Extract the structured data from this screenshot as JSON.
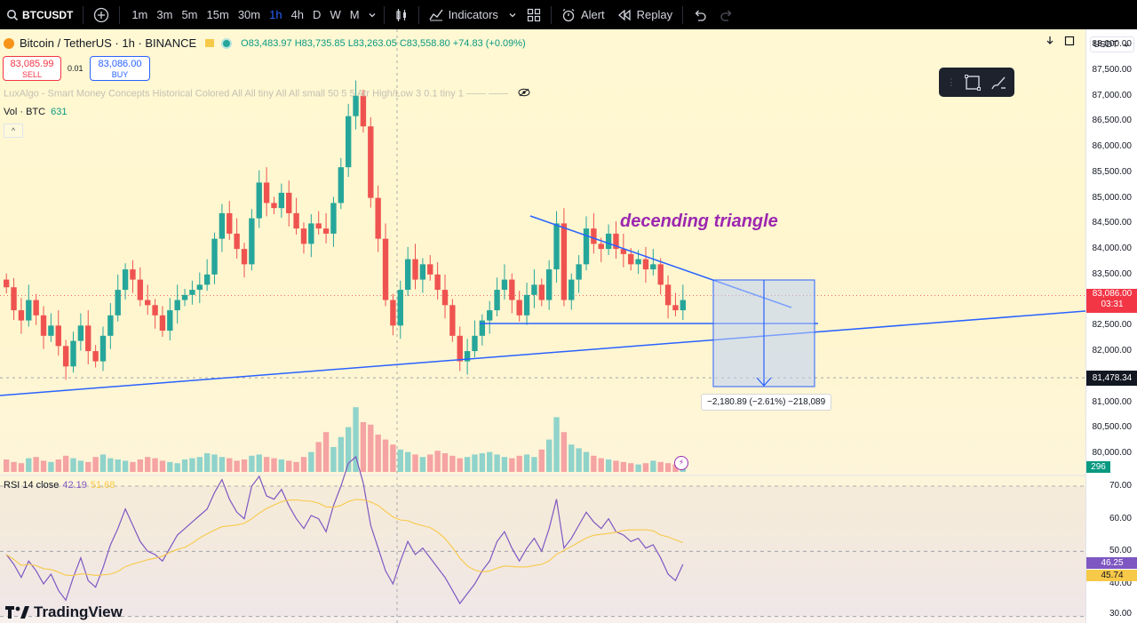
{
  "toolbar": {
    "symbol": "BTCUSDT",
    "timeframes": [
      {
        "label": "1m",
        "active": false
      },
      {
        "label": "3m",
        "active": false
      },
      {
        "label": "5m",
        "active": false
      },
      {
        "label": "15m",
        "active": false
      },
      {
        "label": "30m",
        "active": false
      },
      {
        "label": "1h",
        "active": true
      },
      {
        "label": "4h",
        "active": false
      },
      {
        "label": "D",
        "active": false
      },
      {
        "label": "W",
        "active": false
      },
      {
        "label": "M",
        "active": false
      }
    ],
    "indicators_label": "Indicators",
    "alert_label": "Alert",
    "replay_label": "Replay",
    "icons": [
      "search-icon",
      "add-symbol-icon",
      "chevron-down-icon",
      "candles-icon",
      "indicators-icon",
      "templates-icon",
      "alert-icon",
      "replay-icon",
      "undo-icon",
      "redo-icon"
    ]
  },
  "legend": {
    "title": "Bitcoin / TetherUS · 1h · BINANCE",
    "open": "O83,483.97",
    "high": "H83,735.85",
    "low": "L83,263.05",
    "close": "C83,558.80",
    "change": "+74.83 (+0.09%)"
  },
  "trade": {
    "sell_price": "83,085.99",
    "sell_label": "SELL",
    "spread": "0.01",
    "buy_price": "83,086.00",
    "buy_label": "BUY"
  },
  "indicator_legend": "LuxAlgo - Smart Money Concepts Historical Colored All All tiny All All small 50 5 5 Atr High/Low 3 0.1 tiny 1 —— ——",
  "volume_legend": {
    "label": "Vol · BTC",
    "value": "631"
  },
  "collapse_label": "^",
  "annotation": "decending triangle",
  "measure": "−2,180.89 (−2.61%) −218,089",
  "rsi_legend": {
    "label": "RSI 14 close",
    "value": "42.19",
    "ma": "51.68"
  },
  "brand": "TradingView",
  "price_axis": {
    "currency": "USDT",
    "ticks": [
      "88,000.00",
      "87,500.00",
      "87,000.00",
      "86,500.00",
      "86,000.00",
      "85,500.00",
      "85,000.00",
      "84,500.00",
      "84,000.00",
      "83,500.00",
      "82,500.00",
      "82,000.00",
      "81,000.00",
      "80,500.00",
      "80,000.00"
    ],
    "current_price": "83,086.00",
    "countdown": "03:31",
    "crosshair_price": "81,478.34",
    "volume_badge": "296",
    "rsi_ticks": [
      "70.00",
      "60.00",
      "50.00",
      "40.00",
      "30.00"
    ],
    "rsi_value": "46.25",
    "rsi_ma_value": "45.74"
  },
  "colors": {
    "up": "#26a69a",
    "down": "#ef5350",
    "trendline": "#2962ff",
    "rsi": "#7e57c2",
    "rsi_ma": "#f7c948",
    "annotation": "#9c27b0"
  },
  "chart_data": {
    "type": "candlestick",
    "symbol": "BTCUSDT",
    "interval": "1h",
    "exchange": "BINANCE",
    "price_range": [
      80000,
      88000
    ],
    "closes": [
      83250,
      82800,
      82600,
      83000,
      82700,
      82300,
      82500,
      82100,
      81700,
      82200,
      82500,
      82000,
      81800,
      82300,
      82700,
      83200,
      83600,
      83400,
      83000,
      82900,
      82700,
      82400,
      82800,
      83000,
      83100,
      83200,
      83300,
      83500,
      84200,
      84700,
      84300,
      84000,
      83700,
      84600,
      85300,
      84900,
      84800,
      85100,
      84700,
      84400,
      84100,
      84500,
      84400,
      84300,
      84900,
      85600,
      86600,
      87000,
      86400,
      85000,
      84200,
      83000,
      82500,
      83200,
      83800,
      83400,
      83700,
      83500,
      83200,
      82900,
      82300,
      81800,
      82000,
      82300,
      82600,
      82800,
      83200,
      83400,
      83000,
      82700,
      83100,
      83300,
      83000,
      83600,
      84500,
      83000,
      83400,
      83700,
      84400,
      84100,
      84000,
      84300,
      84000,
      83900,
      83700,
      83800,
      83600,
      83700,
      83300,
      82900,
      82800,
      83000
    ],
    "volumes": [
      50,
      40,
      35,
      55,
      60,
      45,
      40,
      50,
      65,
      55,
      45,
      40,
      60,
      70,
      55,
      50,
      45,
      40,
      50,
      60,
      55,
      45,
      40,
      35,
      50,
      55,
      60,
      75,
      70,
      60,
      55,
      45,
      50,
      65,
      70,
      60,
      55,
      50,
      45,
      40,
      60,
      80,
      120,
      160,
      100,
      140,
      180,
      260,
      200,
      190,
      150,
      130,
      110,
      90,
      80,
      70,
      60,
      70,
      85,
      75,
      65,
      55,
      60,
      70,
      75,
      80,
      70,
      60,
      55,
      65,
      70,
      60,
      90,
      130,
      220,
      160,
      110,
      95,
      80,
      65,
      55,
      50,
      45,
      40,
      35,
      30,
      35,
      45,
      40,
      35,
      30
    ],
    "rsi": [
      49,
      46,
      42,
      47,
      44,
      40,
      43,
      38,
      35,
      42,
      48,
      41,
      39,
      45,
      52,
      57,
      63,
      58,
      53,
      50,
      49,
      47,
      51,
      55,
      57,
      59,
      61,
      63,
      68,
      72,
      66,
      62,
      60,
      70,
      73,
      67,
      66,
      69,
      64,
      60,
      57,
      61,
      60,
      56,
      64,
      70,
      77,
      79,
      71,
      58,
      51,
      44,
      40,
      47,
      53,
      49,
      51,
      48,
      45,
      42,
      38,
      34,
      37,
      40,
      44,
      47,
      53,
      56,
      51,
      47,
      51,
      54,
      50,
      57,
      66,
      51,
      54,
      58,
      62,
      59,
      57,
      60,
      56,
      55,
      53,
      54,
      51,
      52,
      48,
      43,
      41,
      46
    ],
    "rsi_levels": [
      30,
      50,
      70
    ],
    "trendlines": [
      {
        "name": "descending resistance",
        "from": [
          84700
        ],
        "to": [
          83000
        ]
      },
      {
        "name": "horizontal support",
        "value": 82500
      },
      {
        "name": "rising support",
        "from": [
          80900
        ],
        "to": [
          82700
        ]
      }
    ],
    "measure": {
      "delta": -2180.89,
      "percent": -2.61
    }
  }
}
